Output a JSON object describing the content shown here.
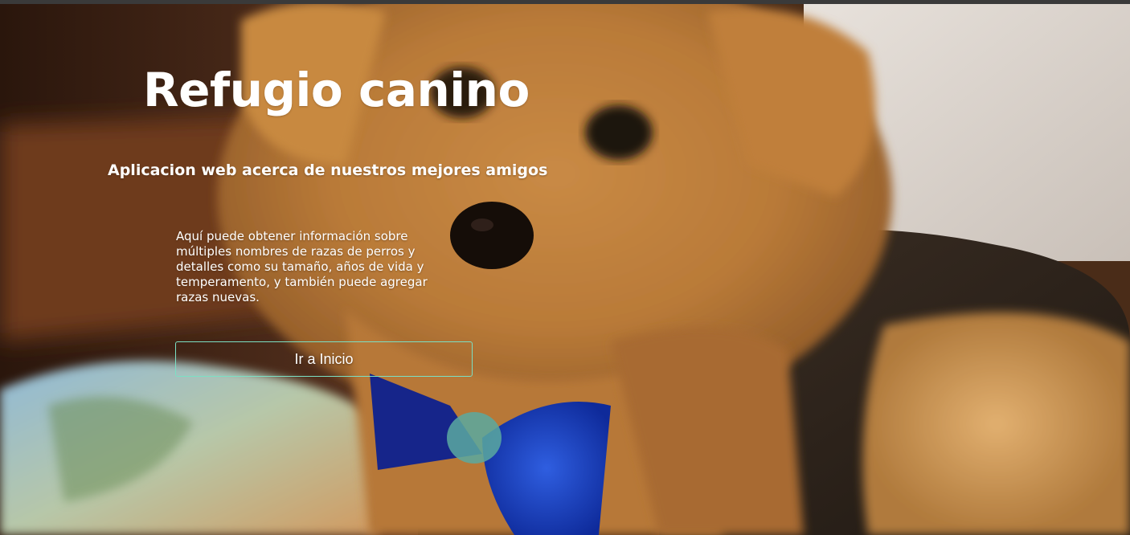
{
  "hero": {
    "title": "Refugio canino",
    "subtitle": "Aplicacion web acerca de nuestros mejores amigos",
    "description": "Aquí puede obtener información sobre múltiples nombres de razas de perros y detalles como su tamaño, años de vida y temperamento, y también puede agregar razas nuevas.",
    "button_label": "Ir a Inicio"
  },
  "colors": {
    "button_border": "#7be0c4",
    "text": "#ffffff"
  }
}
